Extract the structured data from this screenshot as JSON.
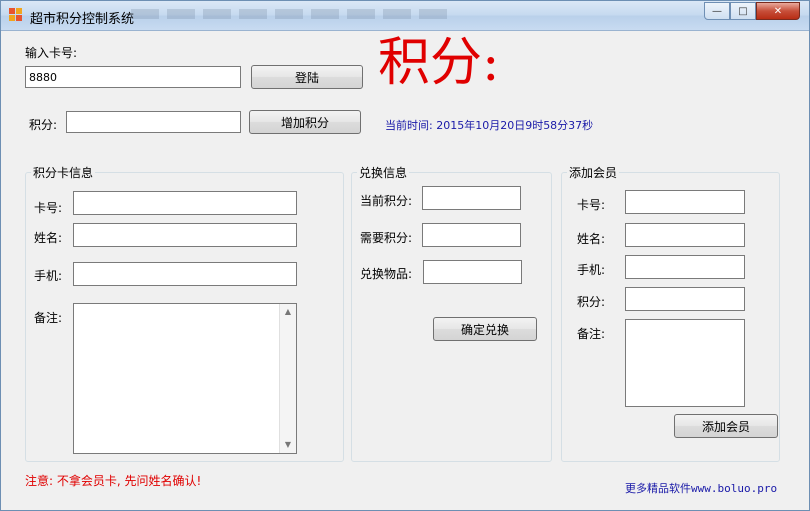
{
  "window": {
    "title": "超市积分控制系统",
    "minimize": "—",
    "maximize": "□",
    "close": "✕"
  },
  "login": {
    "card_label": "输入卡号:",
    "card_value": "8880",
    "login_button": "登陆",
    "points_label": "积分:",
    "points_value": "",
    "add_points_button": "增加积分"
  },
  "banner": {
    "big_title": "积分:",
    "time_text": "当前时间: 2015年10月20日9时58分37秒"
  },
  "card_info": {
    "title": "积分卡信息",
    "card_no": "卡号:",
    "name": "姓名:",
    "phone": "手机:",
    "notes": "备注:"
  },
  "exchange": {
    "title": "兑换信息",
    "current_points": "当前积分:",
    "required_points": "需要积分:",
    "item": "兑换物品:",
    "confirm_button": "确定兑换"
  },
  "add_member": {
    "title": "添加会员",
    "card_no": "卡号:",
    "name": "姓名:",
    "phone": "手机:",
    "points": "积分:",
    "notes": "备注:",
    "add_button": "添加会员"
  },
  "footer": {
    "notice": "注意: 不拿会员卡, 先问姓名确认!",
    "promo": "更多精品软件www.boluo.pro"
  },
  "colors": {
    "accent_red": "#e00000",
    "link_blue": "#1a1aa8"
  }
}
